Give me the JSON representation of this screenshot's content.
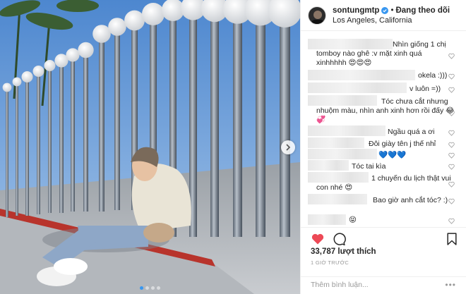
{
  "post": {
    "username": "sontungmtp",
    "separator": "•",
    "follow_status": "Đang theo dõi",
    "location": "Los Angeles, California"
  },
  "icons": {
    "verified": "verified-badge-icon",
    "like": "heart-icon",
    "comment": "comment-bubble-icon",
    "bookmark": "bookmark-icon",
    "next": "chevron-right-icon",
    "more": "ellipsis-icon"
  },
  "comments": [
    {
      "text": "Nhìn giống 1 chị tomboy nào ghê :v mặt xinh quá xinhhhhh 😍😍😍"
    },
    {
      "text": "okela :)))"
    },
    {
      "text": "v luôn =))"
    },
    {
      "text": "Tóc chưa cắt nhưng nhuộm màu, nhìn anh xinh hơn rồi đấy 😂💞"
    },
    {
      "text": "Ngầu quá a ơi"
    },
    {
      "text": "Đôi giày tên j thế nhỉ"
    },
    {
      "text": "💙💙💙"
    },
    {
      "text": "Tóc tai kìa"
    },
    {
      "text": "1 chuyến du lịch thật vui con nhé 😍"
    },
    {
      "text": "Bao giờ anh cắt tóc? :)"
    },
    {
      "text": "😝"
    }
  ],
  "likes": "33,787 lượt thích",
  "time_ago": "1 GIỜ TRƯỚC",
  "comment_input": {
    "placeholder": "Thêm bình luận...",
    "value": ""
  },
  "more_label": "•••",
  "colors": {
    "accent": "#3897f0",
    "like_red": "#ed4956",
    "verified_blue": "#3897f0"
  }
}
